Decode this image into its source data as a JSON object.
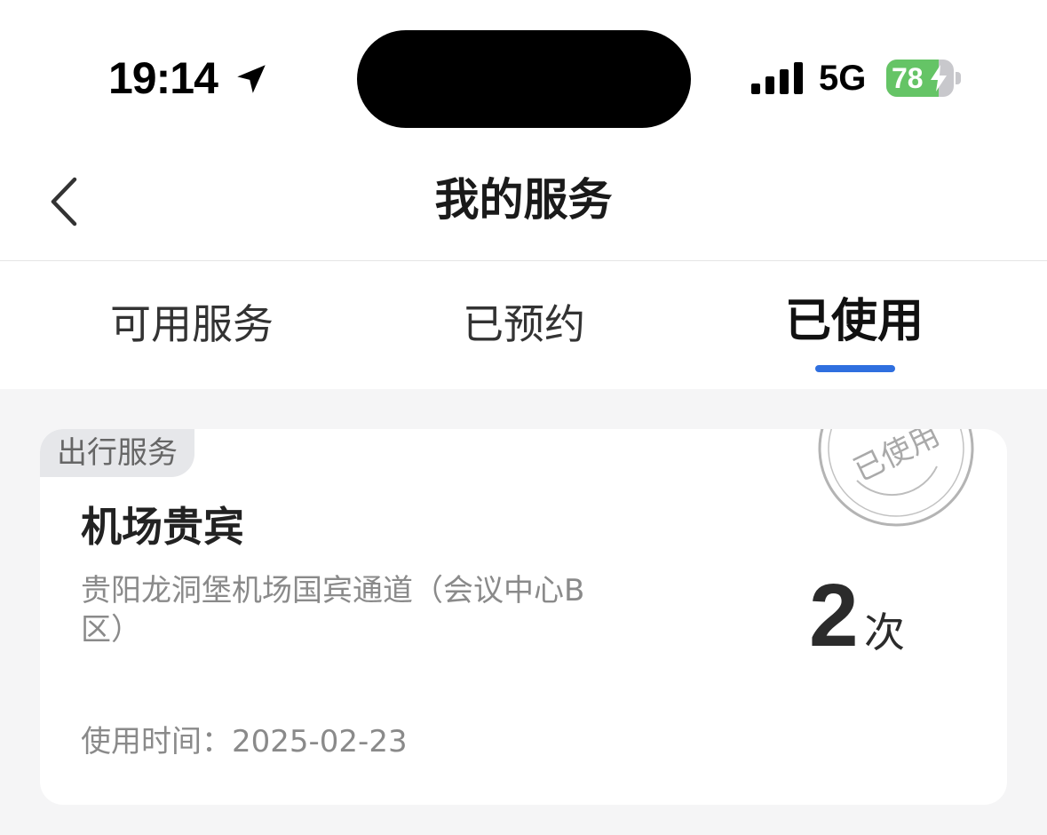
{
  "status_bar": {
    "time": "19:14",
    "network": "5G",
    "battery_percent": "78",
    "battery_level": 0.78,
    "battery_color": "#65c466"
  },
  "nav": {
    "title": "我的服务",
    "back_icon": "chevron-left-icon"
  },
  "tabs": [
    {
      "label": "可用服务",
      "active": false
    },
    {
      "label": "已预约",
      "active": false
    },
    {
      "label": "已使用",
      "active": true
    }
  ],
  "accent_color": "#2f6fdf",
  "service_card": {
    "category": "出行服务",
    "name": "机场贵宾",
    "location": "贵阳龙洞堡机场国宾通道（会议中心B区）",
    "used_time": "使用时间：2025-02-23",
    "stamp_text": "已使用",
    "count": "2",
    "count_unit": "次"
  }
}
